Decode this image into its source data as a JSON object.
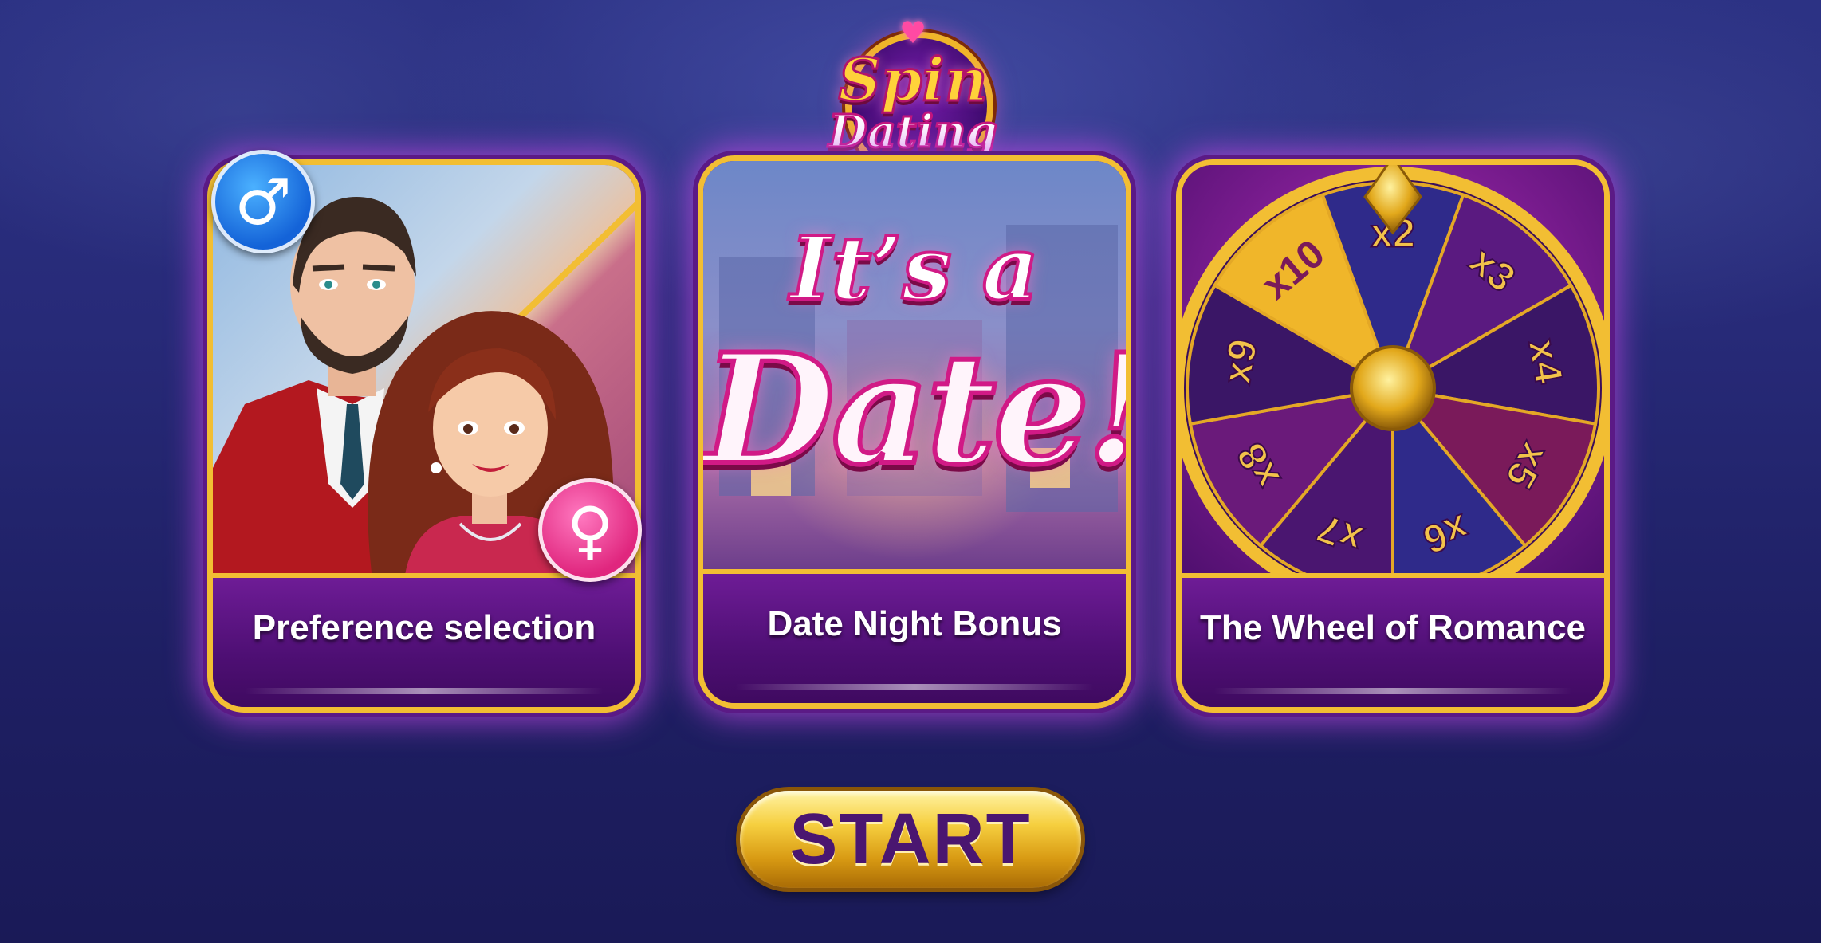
{
  "logo": {
    "line1": "Spin",
    "line2": "Dating"
  },
  "cards": [
    {
      "label": "Preference selection",
      "male_symbol": "♂",
      "female_symbol": "♀"
    },
    {
      "label": "Date Night Bonus",
      "headline_top": "It’s a",
      "headline_bottom": "Date!"
    },
    {
      "label": "The Wheel of Romance",
      "wheel_segments": [
        "x10",
        "x2",
        "x3",
        "x4",
        "x5",
        "x6",
        "x7",
        "x8",
        "x9"
      ]
    }
  ],
  "start_button": {
    "label": "START"
  },
  "colors": {
    "gold": "#f2be33",
    "purple": "#5a137c",
    "pink": "#d11a86",
    "male_blue": "#1463d8",
    "female_pink": "#e0267e"
  }
}
